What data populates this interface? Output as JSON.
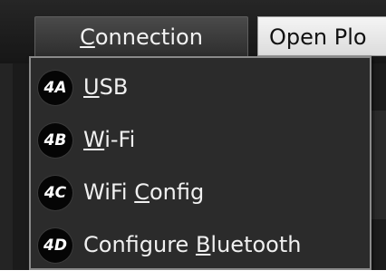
{
  "menubar": {
    "connection_label": "Connection",
    "open_plot_label": "Open Plo"
  },
  "dropdown": {
    "items": [
      {
        "badge": "4A",
        "pre": "",
        "accel": "U",
        "post": "SB"
      },
      {
        "badge": "4B",
        "pre": "",
        "accel": "W",
        "post": "i-Fi"
      },
      {
        "badge": "4C",
        "pre": "WiFi ",
        "accel": "C",
        "post": "onfig"
      },
      {
        "badge": "4D",
        "pre": "Configure ",
        "accel": "B",
        "post": "luetooth"
      }
    ]
  }
}
